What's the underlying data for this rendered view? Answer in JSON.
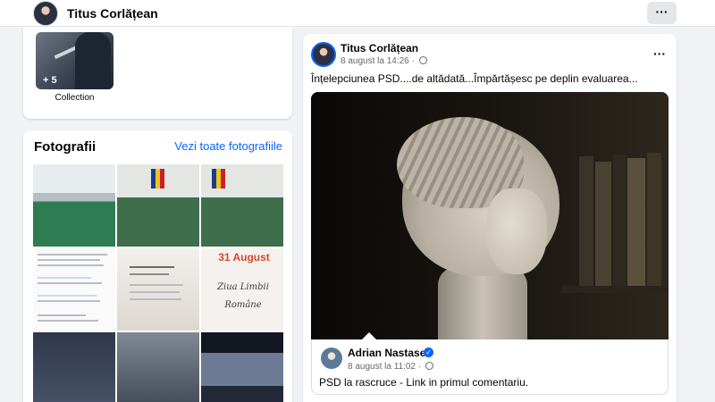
{
  "header": {
    "profile_name": "Titus Corlățean",
    "more_icon": "···"
  },
  "collection": {
    "label": "Collection",
    "count_badge": "+ 5"
  },
  "photos": {
    "title": "Fotografii",
    "see_all": "Vezi toate fotografiile",
    "items": [
      {
        "kind": "room"
      },
      {
        "kind": "room-flags"
      },
      {
        "kind": "room-flags"
      },
      {
        "kind": "comment-doc"
      },
      {
        "kind": "paper"
      },
      {
        "kind": "august",
        "title": "31 August",
        "script_line1": "Ziua Limbii",
        "script_line2": "Române"
      },
      {
        "kind": "group"
      },
      {
        "kind": "hall"
      },
      {
        "kind": "screen"
      }
    ]
  },
  "post": {
    "author": "Titus Corlățean",
    "timestamp": "8 august la 14:26",
    "privacy_icon": "globe-icon",
    "menu_icon": "···",
    "text": "Înțelepciunea PSD....de altădată...Împărtășesc pe deplin evaluarea...",
    "shared": {
      "author": "Adrian Nastase",
      "verified_icon": "✓",
      "timestamp": "8 august la 11:02",
      "text": "PSD la rascruce - Link in primul comentariu."
    }
  },
  "colors": {
    "accent": "#0866ff",
    "background": "#f0f2f5",
    "secondary_text": "#65676b"
  }
}
